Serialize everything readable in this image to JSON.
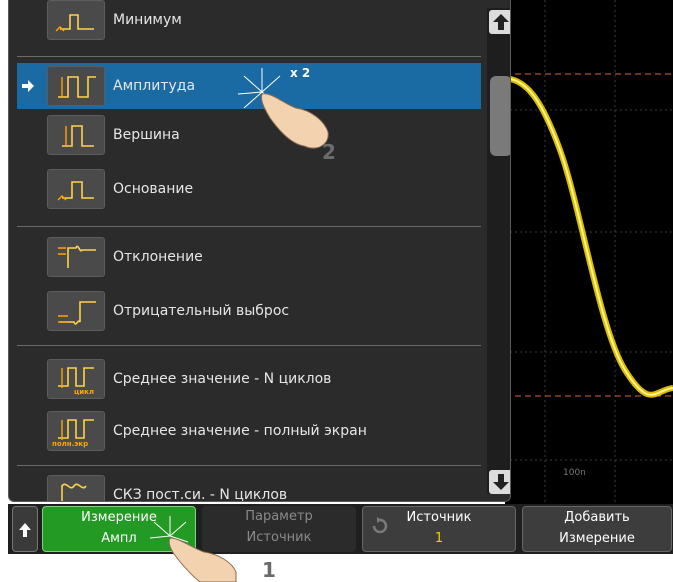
{
  "menu": {
    "items": [
      {
        "label": "Минимум",
        "icon": "minimum-icon",
        "selected": false
      },
      {
        "label": "Амплитуда",
        "icon": "amplitude-icon",
        "selected": true
      },
      {
        "label": "Вершина",
        "icon": "top-icon",
        "selected": false
      },
      {
        "label": "Основание",
        "icon": "base-icon",
        "selected": false
      },
      {
        "label": "Отклонение",
        "icon": "overshoot-icon",
        "selected": false
      },
      {
        "label": "Отрицательный выброс",
        "icon": "preshoot-icon",
        "selected": false
      },
      {
        "label": "Среднее значение - N циклов",
        "icon": "average-n-cycles-icon",
        "icon_text": "цикл",
        "selected": false
      },
      {
        "label": "Среднее значение - полный экран",
        "icon": "average-full-screen-icon",
        "icon_text": "полн.экр",
        "selected": false
      },
      {
        "label": "СКЗ пост.си. - N циклов",
        "icon": "rms-dc-n-cycles-icon",
        "selected": false
      }
    ]
  },
  "annotations": {
    "tap_count": "x 2",
    "step1": "1",
    "step2": "2"
  },
  "scope": {
    "timebase_label": "100n",
    "trace_color": "#f2d000",
    "cursor_color": "#d2693c"
  },
  "softkeys": {
    "back_icon": "up-arrow-icon",
    "measurement": {
      "line1": "Измерение",
      "line2": "Ампл"
    },
    "parameter": {
      "line1": "Параметр",
      "line2": "Источник"
    },
    "source": {
      "line1": "Источник",
      "line2": "1"
    },
    "add": {
      "line1": "Добавить",
      "line2": "Измерение"
    }
  },
  "colors": {
    "selected_item": "#1a6aa4",
    "measurement_key": "#239a23",
    "source_value": "#f2d000"
  }
}
